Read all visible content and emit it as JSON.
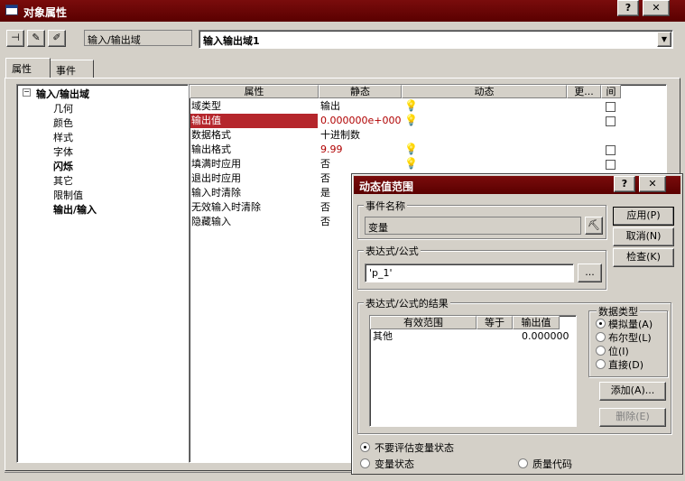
{
  "window": {
    "title": "对象属性",
    "help_btn": "?",
    "close_btn": "✕"
  },
  "toolbar": {
    "object_type": "输入/输出域",
    "object_name": "输入输出域1"
  },
  "tabs": [
    "属性",
    "事件"
  ],
  "tree": {
    "root": "输入/输出域",
    "items": [
      "几何",
      "颜色",
      "样式",
      "字体",
      "闪烁",
      "其它",
      "限制值",
      "输出/输入"
    ]
  },
  "grid": {
    "headers": [
      "属性",
      "静态",
      "动态",
      "更...",
      "间"
    ],
    "rows": [
      {
        "property": "域类型",
        "static": "输出",
        "bulb": true,
        "chk": true
      },
      {
        "property": "输出值",
        "static": "0.000000e+000",
        "bulb": true,
        "chk": true
      },
      {
        "property": "数据格式",
        "static": "十进制数",
        "bulb": false,
        "chk": false
      },
      {
        "property": "输出格式",
        "static": "9.99",
        "bulb": true,
        "chk": true
      },
      {
        "property": "填满时应用",
        "static": "否",
        "bulb": true,
        "chk": true
      },
      {
        "property": "退出时应用",
        "static": "否",
        "bulb": false,
        "chk": false
      },
      {
        "property": "输入时清除",
        "static": "是",
        "bulb": false,
        "chk": false
      },
      {
        "property": "无效输入时清除",
        "static": "否",
        "bulb": false,
        "chk": false
      },
      {
        "property": "隐藏输入",
        "static": "否",
        "bulb": false,
        "chk": false
      }
    ]
  },
  "dialog": {
    "title": "动态值范围",
    "event_name_label": "事件名称",
    "event_name_value": "变量",
    "expr_label": "表达式/公式",
    "expr_value": "'p_1'",
    "expr_browse": "...",
    "result_label": "表达式/公式的结果",
    "result_headers": [
      "有效范围",
      "等于",
      "输出值"
    ],
    "result_rows": [
      {
        "range": "其他",
        "equals": "",
        "output": "0.000000"
      }
    ],
    "data_type_label": "数据类型",
    "data_types": [
      "模拟量(A)",
      "布尔型(L)",
      "位(I)",
      "直接(D)"
    ],
    "selected_type": 0,
    "btn_apply": "应用(P)",
    "btn_cancel": "取消(N)",
    "btn_check": "检查(K)",
    "btn_add": "添加(A)...",
    "btn_delete": "删除(E)",
    "eval_options": [
      "不要评估变量状态",
      "变量状态",
      "质量代码"
    ],
    "selected_eval": 0
  }
}
